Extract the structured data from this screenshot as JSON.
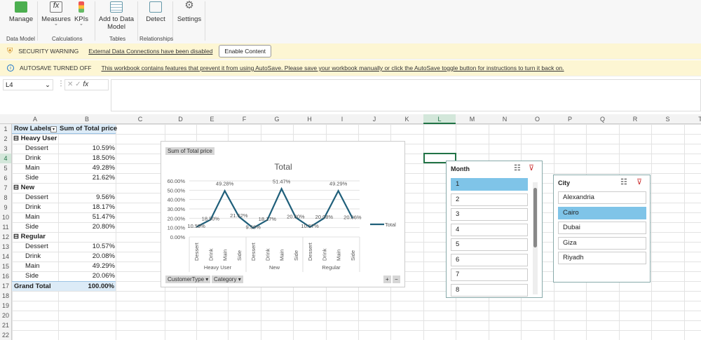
{
  "ribbon": {
    "buttons": [
      {
        "label": "Manage",
        "icon": "data-model-icon"
      },
      {
        "label": "Measures",
        "icon": "fx-icon"
      },
      {
        "label": "KPIs",
        "icon": "kpi-icon"
      },
      {
        "label": "Add to Data Model",
        "icon": "table-icon"
      },
      {
        "label": "Detect",
        "icon": "detect-icon"
      },
      {
        "label": "Settings",
        "icon": "gear-icon"
      }
    ],
    "groups": [
      "Data Model",
      "Calculations",
      "Tables",
      "Relationships"
    ]
  },
  "security": {
    "title": "SECURITY WARNING",
    "message": "External Data Connections have been disabled",
    "button": "Enable Content"
  },
  "autosave": {
    "title": "AUTOSAVE TURNED OFF",
    "message": "This workbook contains features that prevent it from using AutoSave. Please save your workbook manually or click the AutoSave toggle button for instructions to turn it back on."
  },
  "formula_bar": {
    "name_box": "L4",
    "fx": "fx",
    "value": ""
  },
  "columns": [
    "A",
    "B",
    "C",
    "D",
    "E",
    "F",
    "G",
    "H",
    "I",
    "J",
    "K",
    "L",
    "M",
    "N",
    "O",
    "P",
    "Q",
    "R",
    "S",
    "T"
  ],
  "rows": [
    "1",
    "2",
    "3",
    "4",
    "5",
    "6",
    "7",
    "8",
    "9",
    "10",
    "11",
    "12",
    "13",
    "14",
    "15",
    "16",
    "17",
    "18",
    "19",
    "20",
    "21",
    "22"
  ],
  "pivot": {
    "header": [
      "Row Labels",
      "Sum of Total price"
    ],
    "rows": [
      [
        "Heavy User",
        ""
      ],
      [
        "Dessert",
        "10.59%"
      ],
      [
        "Drink",
        "18.50%"
      ],
      [
        "Main",
        "49.28%"
      ],
      [
        "Side",
        "21.62%"
      ],
      [
        "New",
        ""
      ],
      [
        "Dessert",
        "9.56%"
      ],
      [
        "Drink",
        "18.17%"
      ],
      [
        "Main",
        "51.47%"
      ],
      [
        "Side",
        "20.80%"
      ],
      [
        "Regular",
        ""
      ],
      [
        "Dessert",
        "10.57%"
      ],
      [
        "Drink",
        "20.08%"
      ],
      [
        "Main",
        "49.29%"
      ],
      [
        "Side",
        "20.06%"
      ]
    ],
    "total": [
      "Grand Total",
      "100.00%"
    ]
  },
  "chart_data": {
    "type": "line",
    "title": "Total",
    "field_button": "Sum of Total price",
    "legend": "Total",
    "legend_position": "right",
    "groups": [
      "Heavy User",
      "New",
      "Regular"
    ],
    "categories": [
      "Dessert",
      "Drink",
      "Main",
      "Side",
      "Dessert",
      "Drink",
      "Main",
      "Side",
      "Dessert",
      "Drink",
      "Main",
      "Side"
    ],
    "values": [
      10.59,
      18.5,
      49.28,
      21.62,
      9.56,
      18.17,
      51.47,
      20.8,
      10.57,
      20.08,
      49.29,
      20.06
    ],
    "labels": [
      "10.59%",
      "18.50%",
      "49.28%",
      "21.62%",
      "9.56%",
      "18.17%",
      "51.47%",
      "20.80%",
      "10.57%",
      "20.08%",
      "49.29%",
      "20.06%"
    ],
    "ylim": [
      0,
      60
    ],
    "yticks": [
      "0.00%",
      "10.00%",
      "20.00%",
      "30.00%",
      "40.00%",
      "50.00%",
      "60.00%"
    ],
    "axis_buttons": [
      "CustomerType",
      "Category"
    ],
    "color": "#1f5f7a"
  },
  "month_slicer": {
    "title": "Month",
    "items": [
      "1",
      "2",
      "3",
      "4",
      "5",
      "6",
      "7",
      "8"
    ],
    "selected": "1"
  },
  "city_slicer": {
    "title": "City",
    "items": [
      "Alexandria",
      "Cairo",
      "Dubai",
      "Giza",
      "Riyadh"
    ],
    "selected": "Cairo"
  }
}
